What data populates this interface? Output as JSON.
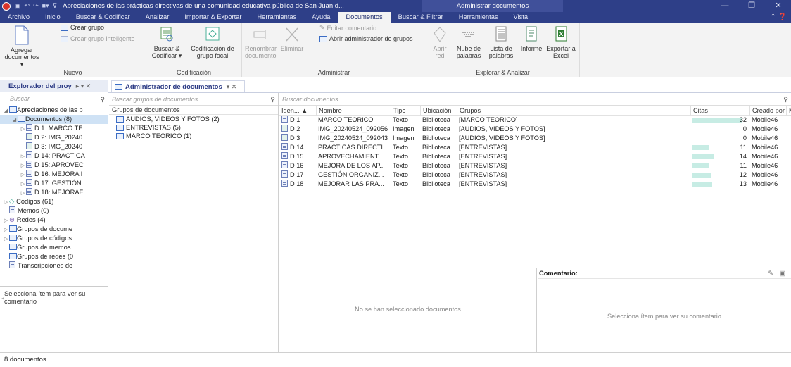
{
  "titlebar": {
    "title": "Apreciaciones de las prácticas directivas de una comunidad educativa pública de San Juan d...",
    "context_title": "Administrar documentos",
    "minimize": "—",
    "restore": "❐",
    "close": "✕"
  },
  "tabs": [
    {
      "label": "Archivo"
    },
    {
      "label": "Inicio"
    },
    {
      "label": "Buscar & Codificar"
    },
    {
      "label": "Analizar"
    },
    {
      "label": "Importar & Exportar"
    },
    {
      "label": "Herramientas"
    },
    {
      "label": "Ayuda"
    },
    {
      "label": "Documentos"
    },
    {
      "label": "Buscar & Filtrar"
    },
    {
      "label": "Herramientas"
    },
    {
      "label": "Vista"
    }
  ],
  "ribbon": {
    "nuevo": {
      "group_label": "Nuevo",
      "agregar": "Agregar documentos ▾",
      "crear_grupo": "Crear grupo",
      "crear_grupo_inteligente": "Crear grupo inteligente"
    },
    "codificacion": {
      "group_label": "Codificación",
      "buscar_codificar": "Buscar & Codificar ▾",
      "codificacion_focal": "Codificación de grupo focal"
    },
    "administrar": {
      "group_label": "Administrar",
      "renombrar": "Renombrar documento",
      "eliminar": "Eliminar",
      "editar_comentario": "Editar comentario",
      "abrir_admin_grupos": "Abrir administrador de grupos"
    },
    "explorar": {
      "group_label": "Explorar & Analizar",
      "abrir_red": "Abrir red",
      "nube": "Nube de palabras",
      "lista": "Lista de palabras",
      "informe": "Informe",
      "exportar": "Exportar a Excel"
    }
  },
  "left_panel": {
    "title": "Explorador del proy",
    "search_placeholder": "Buscar",
    "tree": [
      {
        "label": "Apreciaciones de las p",
        "indent": 0,
        "arrow": "◢",
        "selected": false
      },
      {
        "label": "Documentos (8)",
        "indent": 1,
        "arrow": "◢",
        "selected": true
      },
      {
        "label": "D 1: MARCO TE",
        "indent": 2,
        "arrow": "▷",
        "selected": false
      },
      {
        "label": "D 2: IMG_20240",
        "indent": 2,
        "arrow": "",
        "selected": false
      },
      {
        "label": "D 3: IMG_20240",
        "indent": 2,
        "arrow": "",
        "selected": false
      },
      {
        "label": "D 14: PRACTICA",
        "indent": 2,
        "arrow": "▷",
        "selected": false
      },
      {
        "label": "D 15: APROVEC",
        "indent": 2,
        "arrow": "▷",
        "selected": false
      },
      {
        "label": "D 16: MEJORA I",
        "indent": 2,
        "arrow": "▷",
        "selected": false
      },
      {
        "label": "D 17: GESTIÓN",
        "indent": 2,
        "arrow": "▷",
        "selected": false
      },
      {
        "label": "D 18: MEJORAF",
        "indent": 2,
        "arrow": "▷",
        "selected": false
      },
      {
        "label": "Códigos (61)",
        "indent": 0,
        "arrow": "▷",
        "selected": false
      },
      {
        "label": "Memos (0)",
        "indent": 0,
        "arrow": "",
        "selected": false
      },
      {
        "label": "Redes (4)",
        "indent": 0,
        "arrow": "▷",
        "selected": false
      },
      {
        "label": "Grupos de docume",
        "indent": 0,
        "arrow": "▷",
        "selected": false
      },
      {
        "label": "Grupos de códigos",
        "indent": 0,
        "arrow": "▷",
        "selected": false
      },
      {
        "label": "Grupos de memos",
        "indent": 0,
        "arrow": "",
        "selected": false
      },
      {
        "label": "Grupos de redes (0",
        "indent": 0,
        "arrow": "",
        "selected": false
      },
      {
        "label": "Transcripciones de",
        "indent": 0,
        "arrow": "",
        "selected": false
      }
    ],
    "comment": "Selecciona ítem para ver su comentario"
  },
  "doc_manager": {
    "tab_title": "Administrador de documentos",
    "groups_search_placeholder": "Buscar grupos de documentos",
    "groups_header": "Grupos de documentos",
    "groups": [
      "AUDIOS, VIDEOS Y FOTOS (2)",
      "ENTREVISTAS (5)",
      "MARCO TEORICO (1)"
    ],
    "docs_search_placeholder": "Buscar documentos",
    "columns": {
      "id": "Iden... ▲",
      "nombre": "Nombre",
      "tipo": "Tipo",
      "ubicacion": "Ubicación",
      "grupos": "Grupos",
      "citas": "Citas",
      "creado": "Creado por",
      "m": "M"
    },
    "rows": [
      {
        "id": "D 1",
        "icon": "text",
        "nombre": "MARCO TEORICO",
        "tipo": "Texto",
        "ubicacion": "Biblioteca",
        "grupos": "[MARCO TEORICO]",
        "citas": 32,
        "creado": "Mobile46"
      },
      {
        "id": "D 2",
        "icon": "image",
        "nombre": "IMG_20240524_092056",
        "tipo": "Imagen",
        "ubicacion": "Biblioteca",
        "grupos": "[AUDIOS, VIDEOS Y FOTOS]",
        "citas": 0,
        "creado": "Mobile46"
      },
      {
        "id": "D 3",
        "icon": "image",
        "nombre": "IMG_20240524_092043",
        "tipo": "Imagen",
        "ubicacion": "Biblioteca",
        "grupos": "[AUDIOS, VIDEOS Y FOTOS]",
        "citas": 0,
        "creado": "Mobile46"
      },
      {
        "id": "D 14",
        "icon": "text",
        "nombre": "PRACTICAS DIRECTI...",
        "tipo": "Texto",
        "ubicacion": "Biblioteca",
        "grupos": "[ENTREVISTAS]",
        "citas": 11,
        "creado": "Mobile46"
      },
      {
        "id": "D 15",
        "icon": "text",
        "nombre": "APROVECHAMIENT...",
        "tipo": "Texto",
        "ubicacion": "Biblioteca",
        "grupos": "[ENTREVISTAS]",
        "citas": 14,
        "creado": "Mobile46"
      },
      {
        "id": "D 16",
        "icon": "text",
        "nombre": "MEJORA DE LOS AP...",
        "tipo": "Texto",
        "ubicacion": "Biblioteca",
        "grupos": "[ENTREVISTAS]",
        "citas": 11,
        "creado": "Mobile46"
      },
      {
        "id": "D 17",
        "icon": "text",
        "nombre": "GESTIÓN ORGANIZ...",
        "tipo": "Texto",
        "ubicacion": "Biblioteca",
        "grupos": "[ENTREVISTAS]",
        "citas": 12,
        "creado": "Mobile46"
      },
      {
        "id": "D 18",
        "icon": "text",
        "nombre": "MEJORAR LAS PRA...",
        "tipo": "Texto",
        "ubicacion": "Biblioteca",
        "grupos": "[ENTREVISTAS]",
        "citas": 13,
        "creado": "Mobile46"
      }
    ],
    "citas_max": 32,
    "no_selection": "No se han seleccionado documentos",
    "comment_label": "Comentario:",
    "comment_placeholder": "Selecciona ítem para ver su comentario"
  },
  "statusbar": {
    "text": "8 documentos"
  },
  "colors": {
    "titlebar": "#2e3f88",
    "bar": "#c7ece4",
    "selection": "#cfe2f5"
  }
}
